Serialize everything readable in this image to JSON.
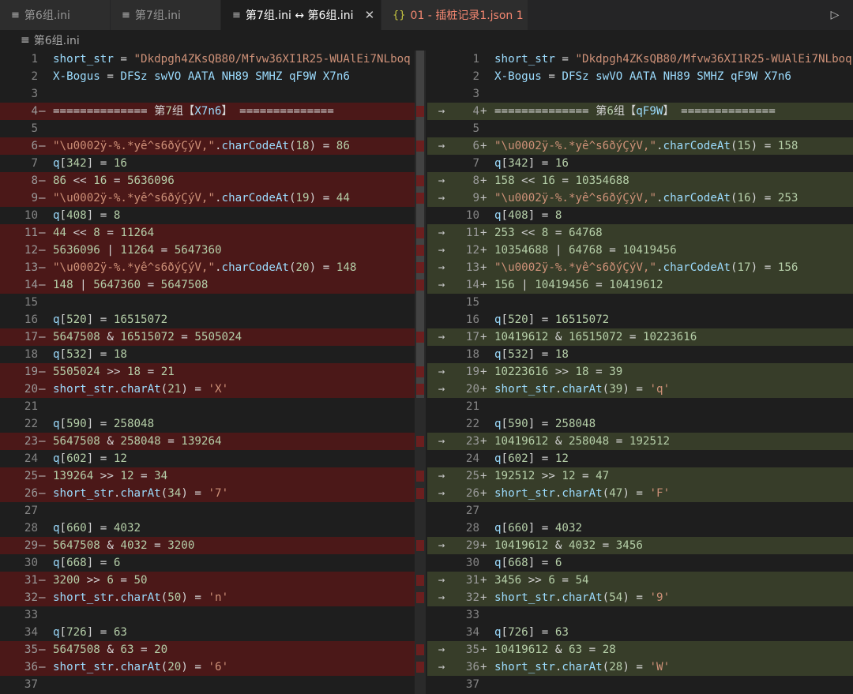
{
  "tabs": [
    {
      "label": "第6组.ini",
      "icon": "≡",
      "active": false
    },
    {
      "label": "第7组.ini",
      "icon": "≡",
      "active": false
    },
    {
      "label": "第7组.ini ↔ 第6组.ini",
      "icon": "≡",
      "active": true,
      "close": "✕"
    },
    {
      "label": "01 - 插桩记录1.json 1",
      "icon": "{}",
      "active": false
    }
  ],
  "run_icon": "▷",
  "breadcrumb": {
    "icon": "≡",
    "label": "第6组.ini"
  },
  "left": [
    {
      "n": "1",
      "t": "ctx",
      "x": "short_str = \"Dkdpgh4ZKsQB80/Mfvw36XI1R25-WUAlEi7NLboq"
    },
    {
      "n": "2",
      "t": "ctx",
      "x": "X-Bogus = DFSz swVO AATA NH89 SMHZ qF9W X7n6"
    },
    {
      "n": "3",
      "t": "ctx",
      "x": ""
    },
    {
      "n": "4",
      "t": "del",
      "x": "============== 第7组【X7n6】 =============="
    },
    {
      "n": "5",
      "t": "ctx",
      "x": ""
    },
    {
      "n": "6",
      "t": "del",
      "x": "\"\\u0002ÿ-%.*yê^\u0002s6ðý\u0000Ç\u0001ý\u0000V,\u0000\".charCodeAt(18) = 86"
    },
    {
      "n": "7",
      "t": "ctx",
      "x": "q[342] = 16"
    },
    {
      "n": "8",
      "t": "del",
      "x": "86 << 16 = 5636096"
    },
    {
      "n": "9",
      "t": "del",
      "x": "\"\\u0002ÿ-%.*yê^\u0002s6ðý\u0000Ç\u0001ý\u0000V,\u0000\".charCodeAt(19) = 44"
    },
    {
      "n": "10",
      "t": "ctx",
      "x": "q[408] = 8"
    },
    {
      "n": "11",
      "t": "del",
      "x": "44 << 8 = 11264"
    },
    {
      "n": "12",
      "t": "del",
      "x": "5636096 | 11264 = 5647360"
    },
    {
      "n": "13",
      "t": "del",
      "x": "\"\\u0002ÿ-%.*yê^\u0002s6ðý\u0000Ç\u0001ý\u0000V,\u0000\".charCodeAt(20) = 148"
    },
    {
      "n": "14",
      "t": "del",
      "x": "148 | 5647360 = 5647508"
    },
    {
      "n": "15",
      "t": "ctx",
      "x": ""
    },
    {
      "n": "16",
      "t": "ctx",
      "x": "q[520] = 16515072"
    },
    {
      "n": "17",
      "t": "del",
      "x": "5647508 & 16515072 = 5505024"
    },
    {
      "n": "18",
      "t": "ctx",
      "x": "q[532] = 18"
    },
    {
      "n": "19",
      "t": "del",
      "x": "5505024 >> 18 = 21"
    },
    {
      "n": "20",
      "t": "del",
      "x": "short_str.charAt(21) = 'X'"
    },
    {
      "n": "21",
      "t": "ctx",
      "x": ""
    },
    {
      "n": "22",
      "t": "ctx",
      "x": "q[590] = 258048"
    },
    {
      "n": "23",
      "t": "del",
      "x": "5647508 & 258048 = 139264"
    },
    {
      "n": "24",
      "t": "ctx",
      "x": "q[602] = 12"
    },
    {
      "n": "25",
      "t": "del",
      "x": "139264 >> 12 = 34"
    },
    {
      "n": "26",
      "t": "del",
      "x": "short_str.charAt(34) = '7'"
    },
    {
      "n": "27",
      "t": "ctx",
      "x": ""
    },
    {
      "n": "28",
      "t": "ctx",
      "x": "q[660] = 4032"
    },
    {
      "n": "29",
      "t": "del",
      "x": "5647508 & 4032 = 3200"
    },
    {
      "n": "30",
      "t": "ctx",
      "x": "q[668] = 6"
    },
    {
      "n": "31",
      "t": "del",
      "x": "3200 >> 6 = 50"
    },
    {
      "n": "32",
      "t": "del",
      "x": "short_str.charAt(50) = 'n'"
    },
    {
      "n": "33",
      "t": "ctx",
      "x": ""
    },
    {
      "n": "34",
      "t": "ctx",
      "x": "q[726] = 63"
    },
    {
      "n": "35",
      "t": "del",
      "x": "5647508 & 63 = 20"
    },
    {
      "n": "36",
      "t": "del",
      "x": "short_str.charAt(20) = '6'"
    },
    {
      "n": "37",
      "t": "ctx",
      "x": ""
    }
  ],
  "right": [
    {
      "n": "1",
      "t": "ctx",
      "x": "short_str = \"Dkdpgh4ZKsQB80/Mfvw36XI1R25-WUAlEi7NLboq"
    },
    {
      "n": "2",
      "t": "ctx",
      "x": "X-Bogus = DFSz swVO AATA NH89 SMHZ qF9W X7n6"
    },
    {
      "n": "3",
      "t": "ctx",
      "x": ""
    },
    {
      "n": "4",
      "t": "add",
      "x": "============== 第6组【qF9W】 =============="
    },
    {
      "n": "5",
      "t": "ctx",
      "x": ""
    },
    {
      "n": "6",
      "t": "add",
      "x": "\"\\u0002ÿ-%.*yê^\u0002s6ðý\u0000Ç\u0001ý\u0000V,\u0000\".charCodeAt(15) = 158"
    },
    {
      "n": "7",
      "t": "ctx",
      "x": "q[342] = 16"
    },
    {
      "n": "8",
      "t": "add",
      "x": "158 << 16 = 10354688"
    },
    {
      "n": "9",
      "t": "add",
      "x": "\"\\u0002ÿ-%.*yê^\u0002s6ðý\u0000Ç\u0001ý\u0000V,\u0000\".charCodeAt(16) = 253"
    },
    {
      "n": "10",
      "t": "ctx",
      "x": "q[408] = 8"
    },
    {
      "n": "11",
      "t": "add",
      "x": "253 << 8 = 64768"
    },
    {
      "n": "12",
      "t": "add",
      "x": "10354688 | 64768 = 10419456"
    },
    {
      "n": "13",
      "t": "add",
      "x": "\"\\u0002ÿ-%.*yê^\u0002s6ðý\u0000Ç\u0001ý\u0000V,\u0000\".charCodeAt(17) = 156"
    },
    {
      "n": "14",
      "t": "add",
      "x": "156 | 10419456 = 10419612"
    },
    {
      "n": "15",
      "t": "ctx",
      "x": ""
    },
    {
      "n": "16",
      "t": "ctx",
      "x": "q[520] = 16515072"
    },
    {
      "n": "17",
      "t": "add",
      "x": "10419612 & 16515072 = 10223616"
    },
    {
      "n": "18",
      "t": "ctx",
      "x": "q[532] = 18"
    },
    {
      "n": "19",
      "t": "add",
      "x": "10223616 >> 18 = 39"
    },
    {
      "n": "20",
      "t": "add",
      "x": "short_str.charAt(39) = 'q'"
    },
    {
      "n": "21",
      "t": "ctx",
      "x": ""
    },
    {
      "n": "22",
      "t": "ctx",
      "x": "q[590] = 258048"
    },
    {
      "n": "23",
      "t": "add",
      "x": "10419612 & 258048 = 192512"
    },
    {
      "n": "24",
      "t": "ctx",
      "x": "q[602] = 12"
    },
    {
      "n": "25",
      "t": "add",
      "x": "192512 >> 12 = 47"
    },
    {
      "n": "26",
      "t": "add",
      "x": "short_str.charAt(47) = 'F'"
    },
    {
      "n": "27",
      "t": "ctx",
      "x": ""
    },
    {
      "n": "28",
      "t": "ctx",
      "x": "q[660] = 4032"
    },
    {
      "n": "29",
      "t": "add",
      "x": "10419612 & 4032 = 3456"
    },
    {
      "n": "30",
      "t": "ctx",
      "x": "q[668] = 6"
    },
    {
      "n": "31",
      "t": "add",
      "x": "3456 >> 6 = 54"
    },
    {
      "n": "32",
      "t": "add",
      "x": "short_str.charAt(54) = '9'"
    },
    {
      "n": "33",
      "t": "ctx",
      "x": ""
    },
    {
      "n": "34",
      "t": "ctx",
      "x": "q[726] = 63"
    },
    {
      "n": "35",
      "t": "add",
      "x": "10419612 & 63 = 28"
    },
    {
      "n": "36",
      "t": "add",
      "x": "short_str.charAt(28) = 'W'"
    },
    {
      "n": "37",
      "t": "ctx",
      "x": ""
    }
  ],
  "colors": {
    "deleted": "#4b1818",
    "added": "#373d29",
    "deleted_word": "#7a2222",
    "added_word": "#4f5d2a"
  },
  "gutter": {
    "del_sign": "—",
    "add_sign": "+",
    "arrow": "→"
  }
}
